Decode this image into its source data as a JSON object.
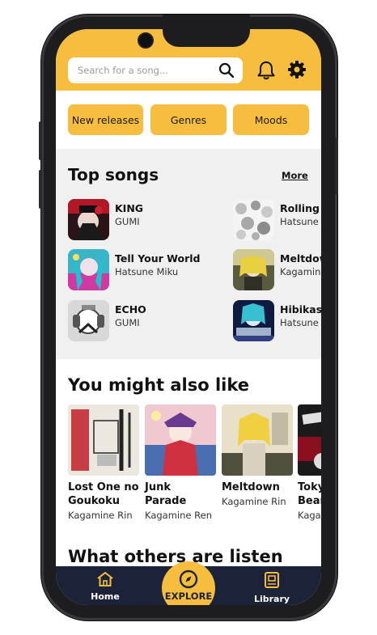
{
  "search": {
    "placeholder": "Search for a song..."
  },
  "categories": [
    "New releases",
    "Genres",
    "Moods"
  ],
  "top_songs": {
    "title": "Top songs",
    "more_label": "More",
    "left": [
      {
        "title": "KING",
        "artist": "GUMI"
      },
      {
        "title": "Tell Your World",
        "artist": "Hatsune Miku"
      },
      {
        "title": "ECHO",
        "artist": "GUMI"
      }
    ],
    "right": [
      {
        "title": "Rolling Girl",
        "artist": "Hatsune Miku"
      },
      {
        "title": "Meltdown",
        "artist": "Kagamine Rin"
      },
      {
        "title": "Hibikase",
        "artist": "Hatsune Miku"
      }
    ]
  },
  "might_like": {
    "title": "You might also like",
    "items": [
      {
        "title": "Lost One no Goukoku",
        "artist": "Kagamine Rin"
      },
      {
        "title": "Junk Parade",
        "artist": "Kagamine Ren"
      },
      {
        "title": "Meltdown",
        "artist": "Kagamine Rin"
      },
      {
        "title": "Tokyo Bear",
        "artist": "Kagamine"
      }
    ]
  },
  "others_title": "What others are listen",
  "nav": {
    "home": "Home",
    "explore": "EXPLORE",
    "library": "Library"
  },
  "colors": {
    "accent": "#f7bd3e",
    "nav_bg": "#1c2237"
  }
}
